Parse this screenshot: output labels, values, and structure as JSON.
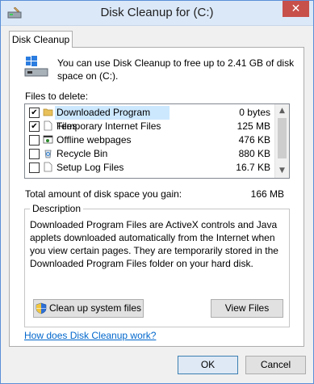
{
  "window": {
    "title": "Disk Cleanup for  (C:)",
    "close_label": "✕"
  },
  "tab": {
    "label": "Disk Cleanup"
  },
  "intro": {
    "text": "You can use Disk Cleanup to free up to 2.41 GB of disk space on  (C:)."
  },
  "files": {
    "label": "Files to delete:",
    "items": [
      {
        "name": "Downloaded Program Files",
        "size": "0 bytes",
        "checked": true,
        "selected": true,
        "icon": "folder-icon"
      },
      {
        "name": "Temporary Internet Files",
        "size": "125 MB",
        "checked": true,
        "selected": false,
        "icon": "document-icon"
      },
      {
        "name": "Offline webpages",
        "size": "476 KB",
        "checked": false,
        "selected": false,
        "icon": "webpage-icon"
      },
      {
        "name": "Recycle Bin",
        "size": "880 KB",
        "checked": false,
        "selected": false,
        "icon": "recycle-bin-icon"
      },
      {
        "name": "Setup Log Files",
        "size": "16.7 KB",
        "checked": false,
        "selected": false,
        "icon": "document-icon"
      }
    ]
  },
  "total": {
    "label": "Total amount of disk space you gain:",
    "value": "166 MB"
  },
  "description": {
    "title": "Description",
    "text": "Downloaded Program Files are ActiveX controls and Java applets downloaded automatically from the Internet when you view certain pages. They are temporarily stored in the Downloaded Program Files folder on your hard disk."
  },
  "buttons": {
    "cleanup_system": "Clean up system files",
    "view_files": "View Files",
    "ok": "OK",
    "cancel": "Cancel"
  },
  "help_link": "How does Disk Cleanup work?",
  "colors": {
    "accent": "#5a8ed6",
    "link": "#0066cc",
    "selection": "#cce8ff",
    "close": "#c7504b"
  }
}
